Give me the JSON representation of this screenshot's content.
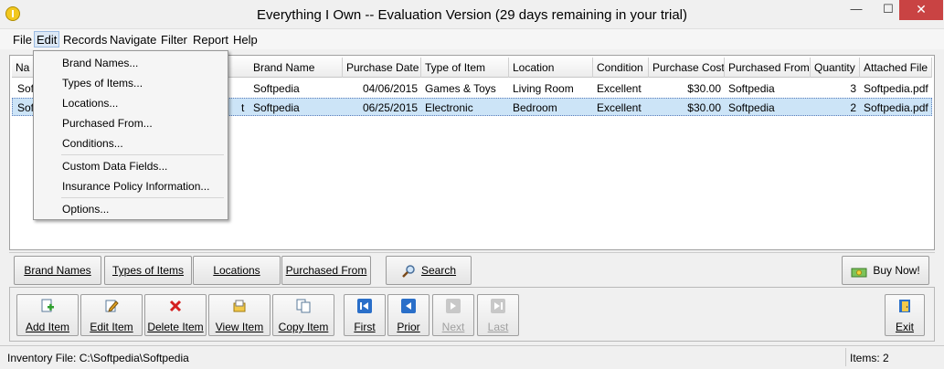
{
  "window": {
    "title": "Everything I Own -- Evaluation Version (29 days remaining in your trial)",
    "min": "—",
    "max": "☐",
    "close": "✕"
  },
  "menu": [
    "File",
    "Edit",
    "Records",
    "Navigate",
    "Filter",
    "Report",
    "Help"
  ],
  "grid": {
    "columns": [
      "Na",
      "Brand Name",
      "Purchase Date",
      "Type of Item",
      "Location",
      "Condition",
      "Purchase Cost",
      "Purchased From",
      "Quantity",
      "Attached File"
    ],
    "rows": [
      {
        "name": "Soft",
        "brand": "Softpedia",
        "date": "04/06/2015",
        "type": "Games & Toys",
        "location": "Living Room",
        "condition": "Excellent",
        "cost": "$30.00",
        "from": "Softpedia",
        "qty": "3",
        "file": "Softpedia.pdf",
        "extra": ""
      },
      {
        "name": "Sof",
        "brand": "Softpedia",
        "date": "06/25/2015",
        "type": "Electronic",
        "location": "Bedroom",
        "condition": "Excellent",
        "cost": "$30.00",
        "from": "Softpedia",
        "qty": "2",
        "file": "Softpedia.pdf",
        "extra": "t"
      }
    ]
  },
  "edit_menu": {
    "items": [
      "Brand Names...",
      "Types of Items...",
      "Locations...",
      "Purchased From...",
      "Conditions...",
      "Custom Data Fields...",
      "Insurance Policy Information...",
      "Options..."
    ]
  },
  "buttons": {
    "brand_names": "Brand Names",
    "types_of_items": "Types of Items",
    "locations": "Locations",
    "purchased_from": "Purchased From",
    "search": "Search",
    "buy_now": "Buy Now!"
  },
  "toolbar": {
    "add": "Add Item",
    "edit": "Edit Item",
    "delete": "Delete Item",
    "view": "View Item",
    "copy": "Copy Item",
    "first": "First",
    "prior": "Prior",
    "next": "Next",
    "last": "Last",
    "exit": "Exit"
  },
  "status": {
    "inventory_file": "Inventory File:  C:\\Softpedia\\Softpedia",
    "items": "Items: 2"
  }
}
